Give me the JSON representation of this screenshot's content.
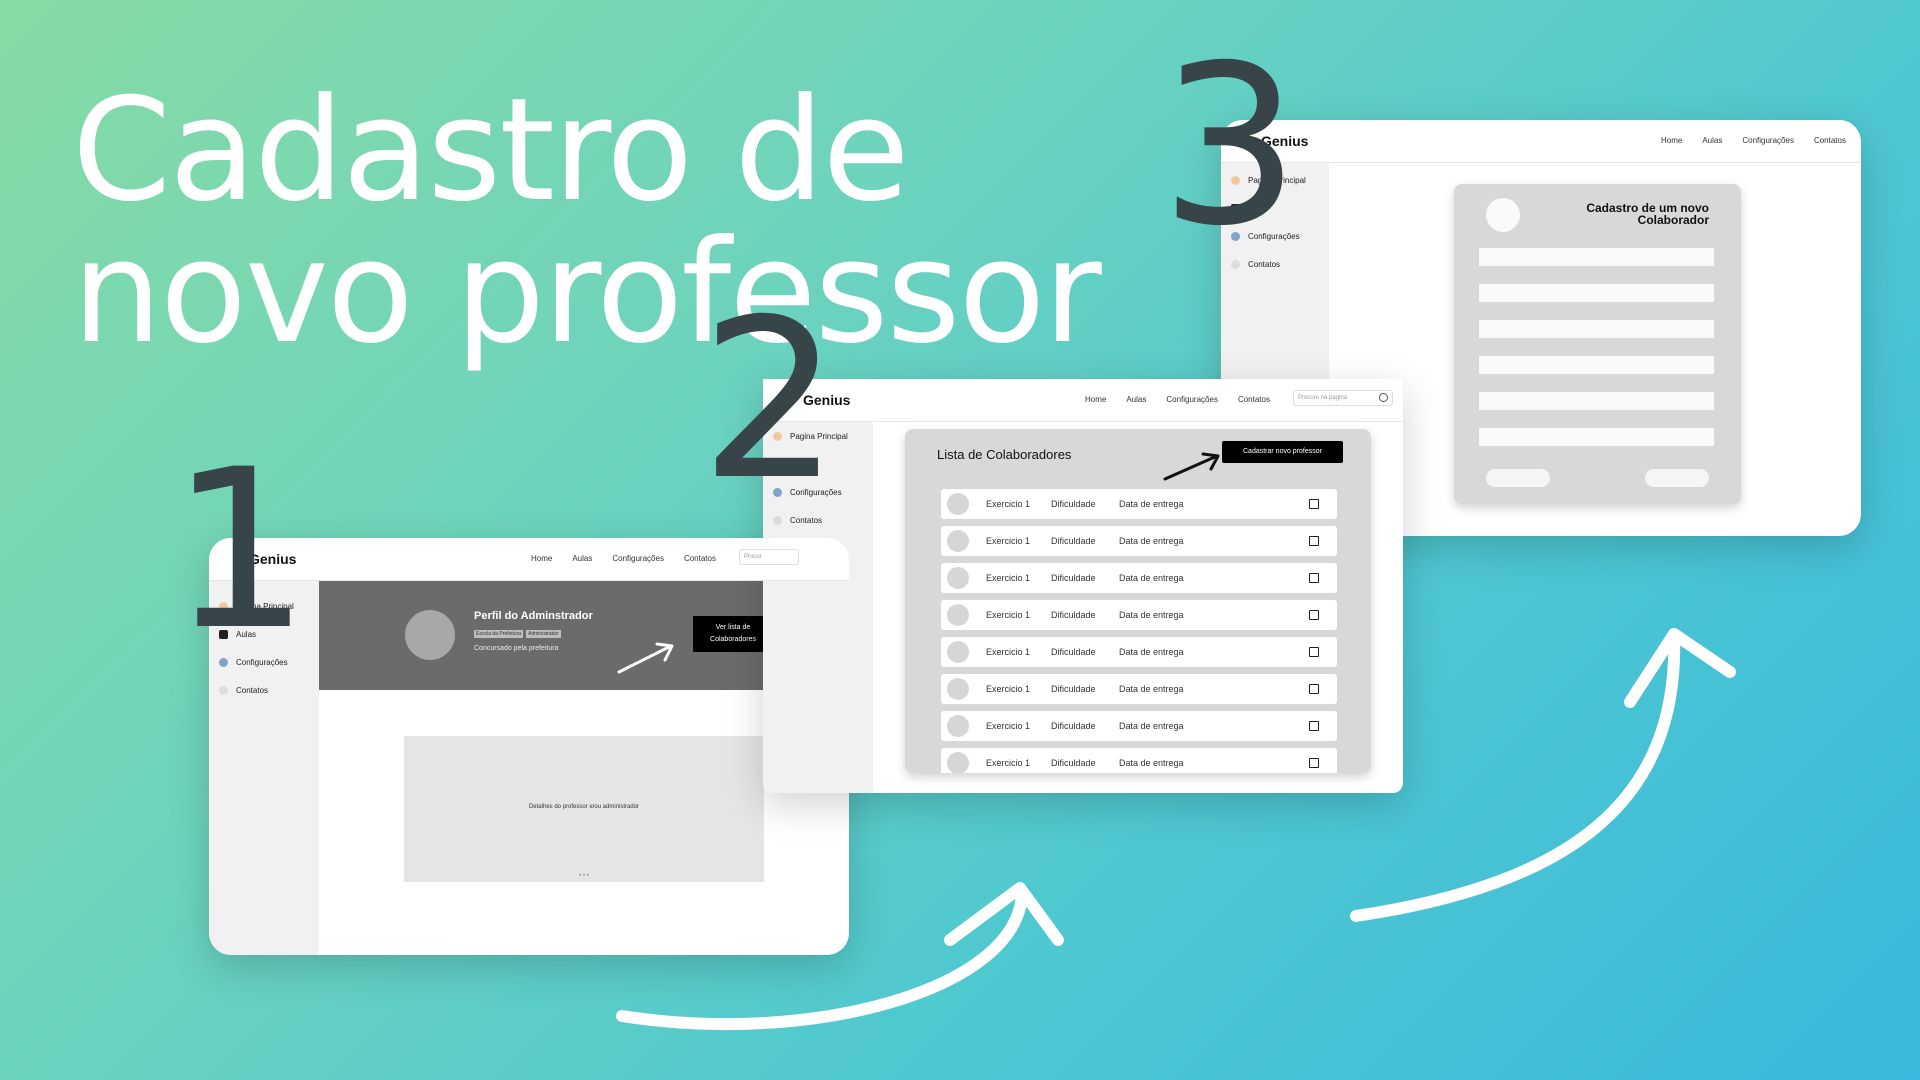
{
  "headline": {
    "line1": "Cadastro de",
    "line2": "novo professor"
  },
  "steps": [
    "1",
    "2",
    "3"
  ],
  "colors": {
    "bg_start": "#86dba4",
    "bg_end": "#3ab8dd",
    "step_number": "#374548",
    "black_button": "#000000",
    "profile_banner": "#6b6b6b"
  },
  "app": {
    "brand": "Genius",
    "nav": [
      "Home",
      "Aulas",
      "Configurações",
      "Contatos"
    ],
    "search_placeholder": "Procure na pagina",
    "sidebar": [
      {
        "label": "Pagina Principal",
        "icon": "home-icon"
      },
      {
        "label": "Aulas",
        "icon": "book-icon"
      },
      {
        "label": "Configurações",
        "icon": "gear-icon"
      },
      {
        "label": "Contatos",
        "icon": "contacts-icon"
      }
    ]
  },
  "screen1": {
    "search_partial": "Procur",
    "profile_title": "Perfil do Adminstrador",
    "tags": [
      "Escola da Prefeitura",
      "Administrador"
    ],
    "subtitle": "Concursado pela prefeitura",
    "button_line1": "Ver lista de",
    "button_line2": "Colaboradores",
    "details_text": "Detalhes do professor e/ou administrador",
    "pager": "• • •"
  },
  "screen2": {
    "list_title": "Lista de Colaboradores",
    "add_button": "Cadastrar novo professor",
    "row": {
      "col1": "Exercicio 1",
      "col2": "Dificuldade",
      "col3": "Data de entrega"
    },
    "row_count": 8
  },
  "screen3": {
    "form_title_line1": "Cadastro de um novo",
    "form_title_line2": "Colaborador",
    "field_count": 6
  }
}
